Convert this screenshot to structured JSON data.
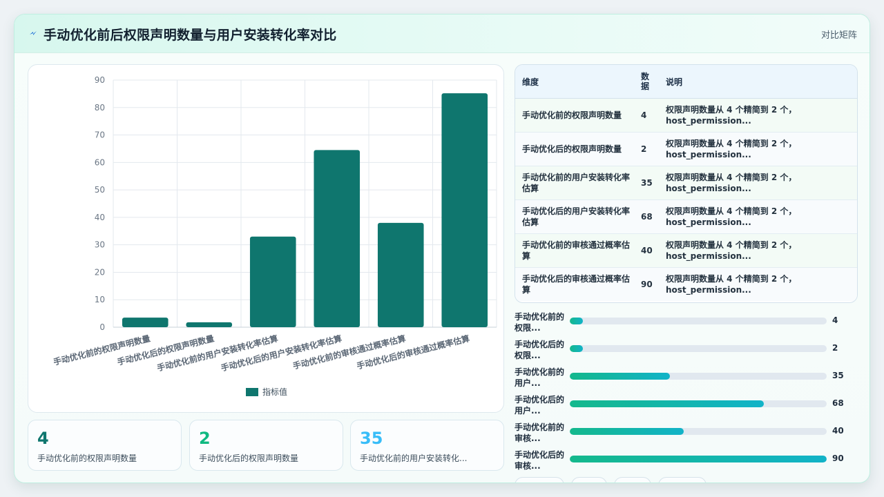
{
  "header": {
    "title": "手动优化前后权限声明数量与用户安装转化率对比",
    "tag": "对比矩阵",
    "accent": "#1e6fd6"
  },
  "chart_data": {
    "type": "bar",
    "categories": [
      "手动优化前的权限声明数量",
      "手动优化后的权限声明数量",
      "手动优化前的用户安装转化率估算",
      "手动优化后的用户安装转化率估算",
      "手动优化前的审核通过概率估算",
      "手动优化后的审核通过概率估算"
    ],
    "series": [
      {
        "name": "指标值",
        "values": [
          3.5,
          1.8,
          33,
          64.5,
          38,
          85.2
        ],
        "color": "#0f766e"
      }
    ],
    "ylim": [
      0,
      90
    ],
    "yticks": [
      0,
      10,
      20,
      30,
      40,
      50,
      60,
      70,
      80,
      90
    ],
    "grid": true,
    "legend": "bottom"
  },
  "kpis": [
    {
      "value": "4",
      "label": "手动优化前的权限声明数量",
      "color": "#0f766e"
    },
    {
      "value": "2",
      "label": "手动优化后的权限声明数量",
      "color": "#10b981"
    },
    {
      "value": "35",
      "label": "手动优化前的用户安装转化...",
      "color": "#38bdf8"
    }
  ],
  "table": {
    "headers": [
      "维度",
      "数据",
      "说明"
    ],
    "rows": [
      {
        "dim": "手动优化前的权限声明数量",
        "value": "4",
        "desc": "权限声明数量从 4 个精简到 2 个，host_permission..."
      },
      {
        "dim": "手动优化后的权限声明数量",
        "value": "2",
        "desc": "权限声明数量从 4 个精简到 2 个，host_permission..."
      },
      {
        "dim": "手动优化前的用户安装转化率估算",
        "value": "35",
        "desc": "权限声明数量从 4 个精简到 2 个，host_permission..."
      },
      {
        "dim": "手动优化后的用户安装转化率估算",
        "value": "68",
        "desc": "权限声明数量从 4 个精简到 2 个，host_permission..."
      },
      {
        "dim": "手动优化前的审核通过概率估算",
        "value": "40",
        "desc": "权限声明数量从 4 个精简到 2 个，host_permission..."
      },
      {
        "dim": "手动优化后的审核通过概率估算",
        "value": "90",
        "desc": "权限声明数量从 4 个精简到 2 个，host_permission..."
      }
    ]
  },
  "progress": {
    "max": 90,
    "items": [
      {
        "label": "手动优化前的权限...",
        "value": 4,
        "display": "4"
      },
      {
        "label": "手动优化后的权限...",
        "value": 2,
        "display": "2"
      },
      {
        "label": "手动优化前的用户...",
        "value": 35,
        "display": "35"
      },
      {
        "label": "手动优化后的用户...",
        "value": 68,
        "display": "68"
      },
      {
        "label": "手动优化前的审核...",
        "value": 40,
        "display": "40"
      },
      {
        "label": "手动优化后的审核...",
        "value": 90,
        "display": "90"
      }
    ]
  }
}
